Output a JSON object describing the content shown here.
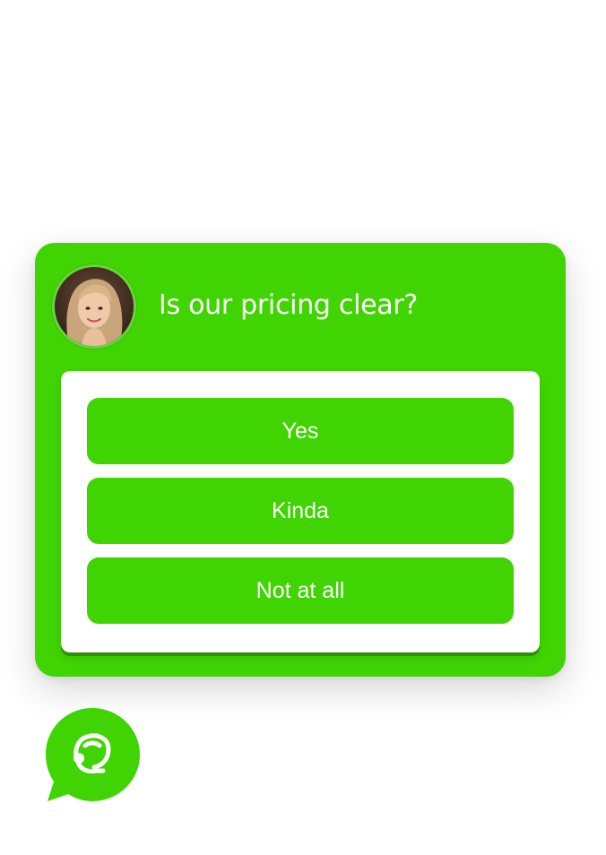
{
  "survey": {
    "question": "Is our pricing clear?",
    "avatar_icon": "user-avatar-photo",
    "answers": [
      {
        "label": "Yes"
      },
      {
        "label": "Kinda"
      },
      {
        "label": "Not at all"
      }
    ]
  },
  "launcher": {
    "icon": "chat-bubble-support-agent-icon"
  },
  "colors": {
    "accent": "#40d403",
    "panel": "#ffffff",
    "text_on_accent": "#ffffff"
  }
}
